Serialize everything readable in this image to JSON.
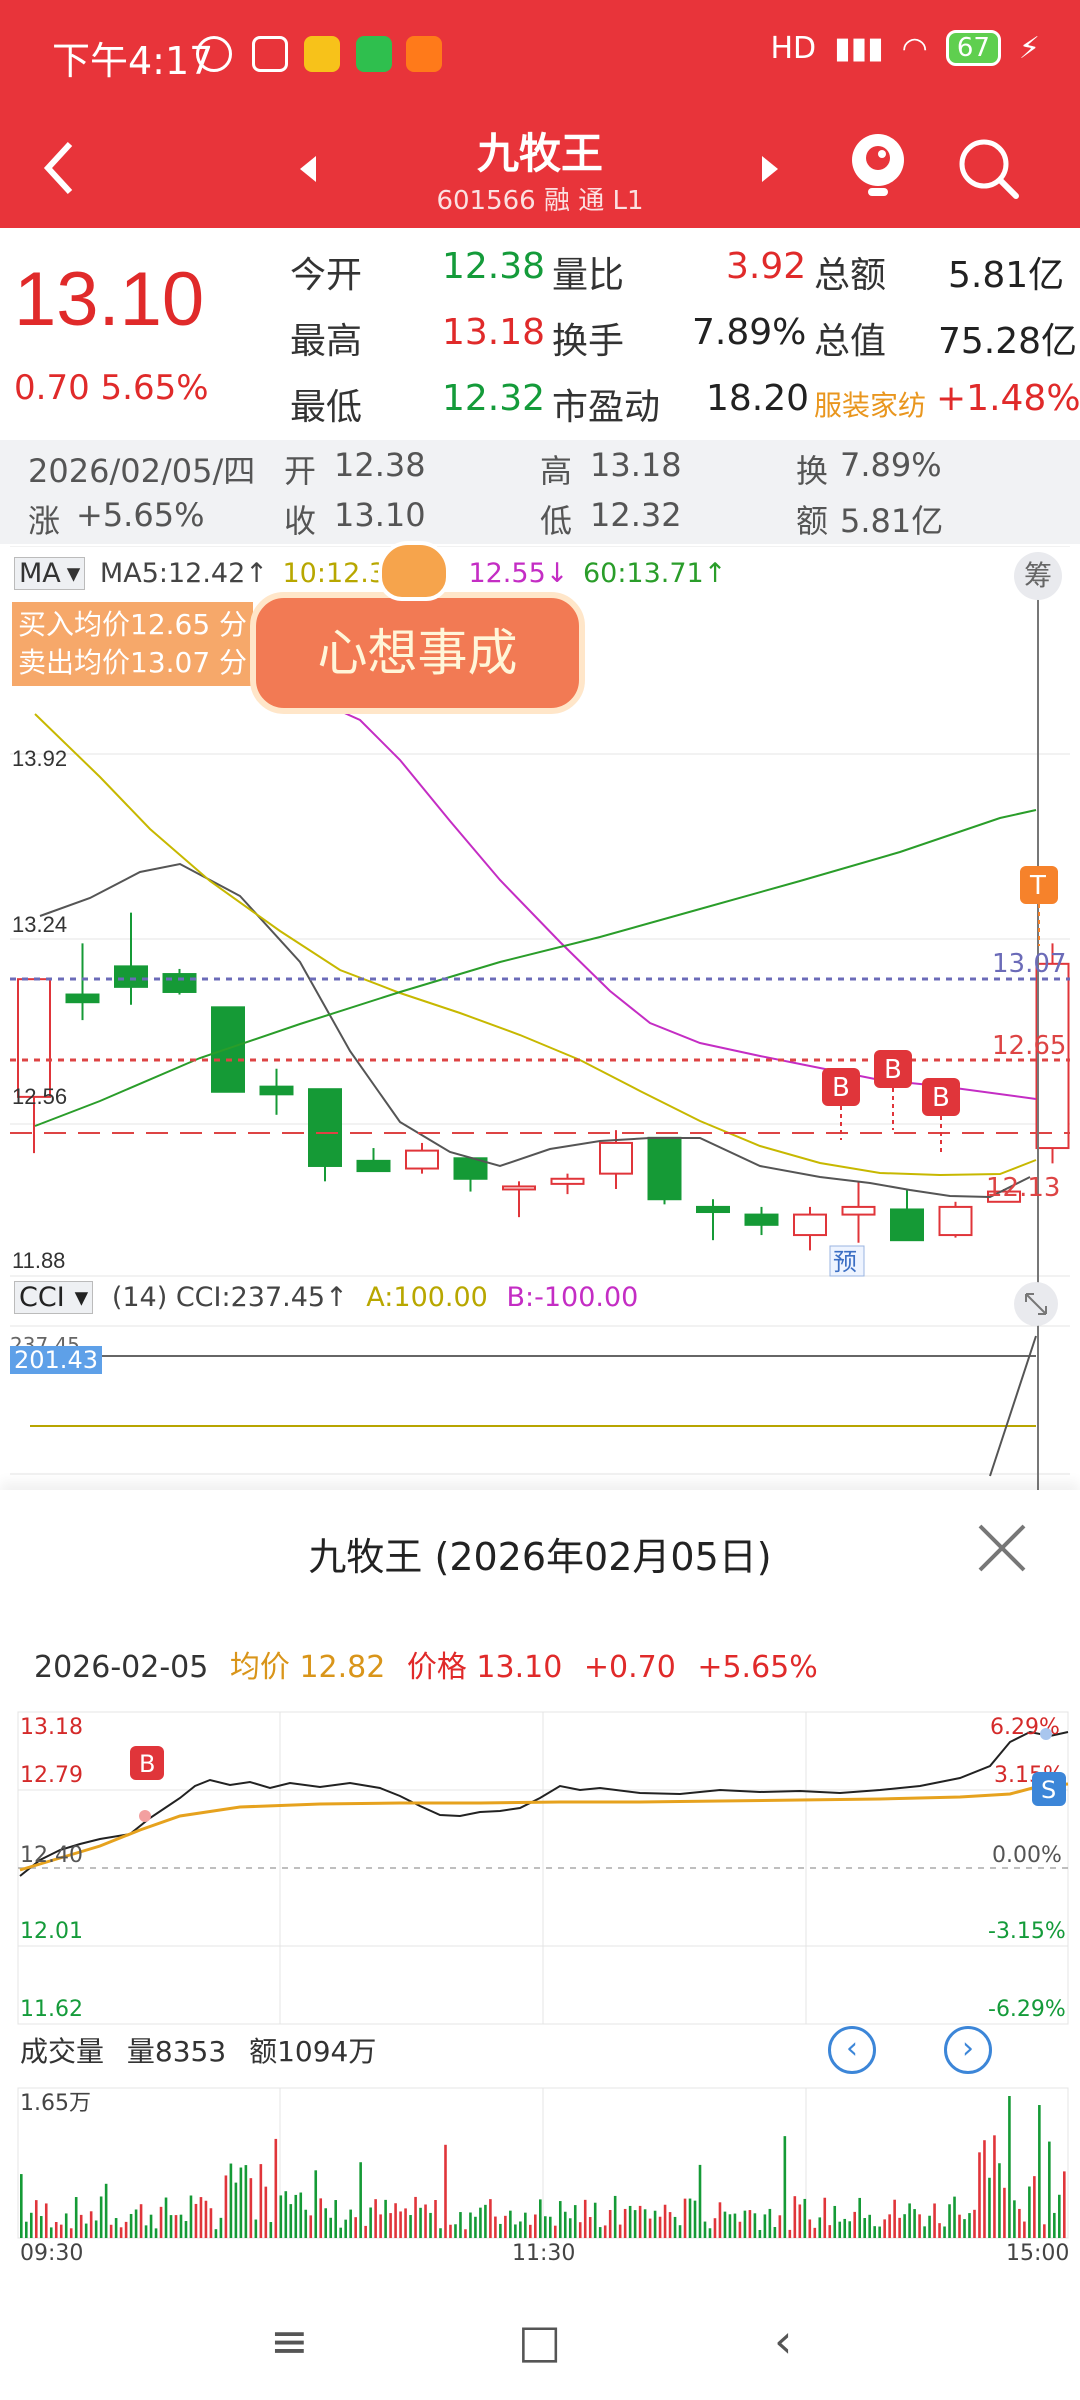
{
  "status_bar": {
    "time": "下午4:17",
    "network": "HD",
    "battery": "67"
  },
  "nav": {
    "title": "九牧王",
    "code": "601566 融 通 L1"
  },
  "quote": {
    "price": "13.10",
    "change": "0.70  5.65%",
    "rows": [
      [
        {
          "label": "今开",
          "value": "12.38",
          "tone": "green"
        },
        {
          "label": "量比",
          "value": "3.92",
          "tone": "red"
        },
        {
          "label": "总额",
          "value": "5.81亿",
          "tone": "dark"
        }
      ],
      [
        {
          "label": "最高",
          "value": "13.18",
          "tone": "red"
        },
        {
          "label": "换手",
          "value": "7.89%",
          "tone": "dark"
        },
        {
          "label": "总值",
          "value": "75.28亿",
          "tone": "dark"
        }
      ],
      [
        {
          "label": "最低",
          "value": "12.32",
          "tone": "green"
        },
        {
          "label": "市盈动",
          "value": "18.20",
          "tone": "dark"
        },
        {
          "label": "服装家纺",
          "value": "+1.48%",
          "tone": "red"
        }
      ]
    ]
  },
  "kbar": {
    "date": "2026/02/05/四",
    "open_label": "开",
    "open": "12.38",
    "high_label": "高",
    "high": "13.18",
    "turnover_label": "换",
    "turnover": "7.89%",
    "rise_label": "涨",
    "rise": "+5.65%",
    "close_label": "收",
    "close": "13.10",
    "low_label": "低",
    "low": "12.32",
    "amount_label": "额",
    "amount": "5.81亿"
  },
  "kline": {
    "ma_button": "MA",
    "ma5": "MA5:12.42↑",
    "ma10": "10:12.36↓",
    "ma20": "12.55↓",
    "ma60": "60:13.71↑",
    "chou": "筹",
    "avg_buy": "买入均价12.65 分",
    "avg_sell": "卖出均价13.07 分",
    "banner": "心想事成",
    "axis": [
      "13.92",
      "13.24",
      "12.56",
      "11.88"
    ],
    "line_labels": [
      "13.07",
      "12.65",
      "12.13"
    ],
    "markers": [
      "B",
      "B",
      "B",
      "T"
    ],
    "forecast": "预",
    "cci_button": "CCI",
    "cci_value": "(14) CCI:237.45↑",
    "cci_a": "A:100.00",
    "cci_b": "B:-100.00",
    "cci_axis_top": "237.45",
    "cci_axis_hl": "201.43"
  },
  "chart_data": {
    "type": "bar",
    "kind": "candlestick",
    "ylim": [
      11.88,
      13.92
    ],
    "candles": [
      {
        "o": 12.58,
        "h": 12.95,
        "l": 12.36,
        "c": 13.04
      },
      {
        "o": 12.98,
        "h": 13.18,
        "l": 12.88,
        "c": 12.95
      },
      {
        "o": 13.09,
        "h": 13.3,
        "l": 12.94,
        "c": 13.01
      },
      {
        "o": 13.06,
        "h": 13.08,
        "l": 12.98,
        "c": 12.99
      },
      {
        "o": 12.93,
        "h": 12.93,
        "l": 12.6,
        "c": 12.6
      },
      {
        "o": 12.62,
        "h": 12.69,
        "l": 12.51,
        "c": 12.59
      },
      {
        "o": 12.61,
        "h": 12.61,
        "l": 12.25,
        "c": 12.31
      },
      {
        "o": 12.33,
        "h": 12.38,
        "l": 12.29,
        "c": 12.29
      },
      {
        "o": 12.3,
        "h": 12.4,
        "l": 12.28,
        "c": 12.37
      },
      {
        "o": 12.34,
        "h": 12.34,
        "l": 12.21,
        "c": 12.26
      },
      {
        "o": 12.23,
        "h": 12.25,
        "l": 12.11,
        "c": 12.23
      },
      {
        "o": 12.24,
        "h": 12.28,
        "l": 12.2,
        "c": 12.26
      },
      {
        "o": 12.28,
        "h": 12.45,
        "l": 12.22,
        "c": 12.4
      },
      {
        "o": 12.42,
        "h": 12.42,
        "l": 12.16,
        "c": 12.18
      },
      {
        "o": 12.15,
        "h": 12.18,
        "l": 12.02,
        "c": 12.13
      },
      {
        "o": 12.12,
        "h": 12.15,
        "l": 12.04,
        "c": 12.08
      },
      {
        "o": 12.04,
        "h": 12.15,
        "l": 11.98,
        "c": 12.12
      },
      {
        "o": 12.12,
        "h": 12.25,
        "l": 12.01,
        "c": 12.15
      },
      {
        "o": 12.14,
        "h": 12.22,
        "l": 12.02,
        "c": 12.02
      },
      {
        "o": 12.04,
        "h": 12.17,
        "l": 12.03,
        "c": 12.15
      },
      {
        "o": 12.17,
        "h": 12.22,
        "l": 12.17,
        "c": 12.21
      },
      {
        "o": 12.38,
        "h": 13.18,
        "l": 12.32,
        "c": 13.1
      }
    ]
  },
  "popup": {
    "title": "九牧王 (2026年02月05日)",
    "date": "2026-02-05",
    "avg_label": "均价 12.82",
    "price_label": "价格 13.10",
    "change": "+0.70",
    "change_pct": "+5.65%",
    "left_axis": [
      "13.18",
      "12.79",
      "12.40",
      "12.01",
      "11.62"
    ],
    "right_axis": [
      "6.29%",
      "3.15%",
      "0.00%",
      "-3.15%",
      "-6.29%"
    ],
    "marker_b": "B",
    "marker_s": "S",
    "vol_title": "成交量",
    "vol": "量8353",
    "amount": "额1094万",
    "vol_axis": "1.65万",
    "time_start": "09:30",
    "time_mid": "11:30",
    "time_end": "15:00",
    "prev_btn": "‹",
    "next_btn": "›"
  },
  "android_nav": {
    "menu": "≡",
    "home": "□",
    "back": "‹"
  }
}
